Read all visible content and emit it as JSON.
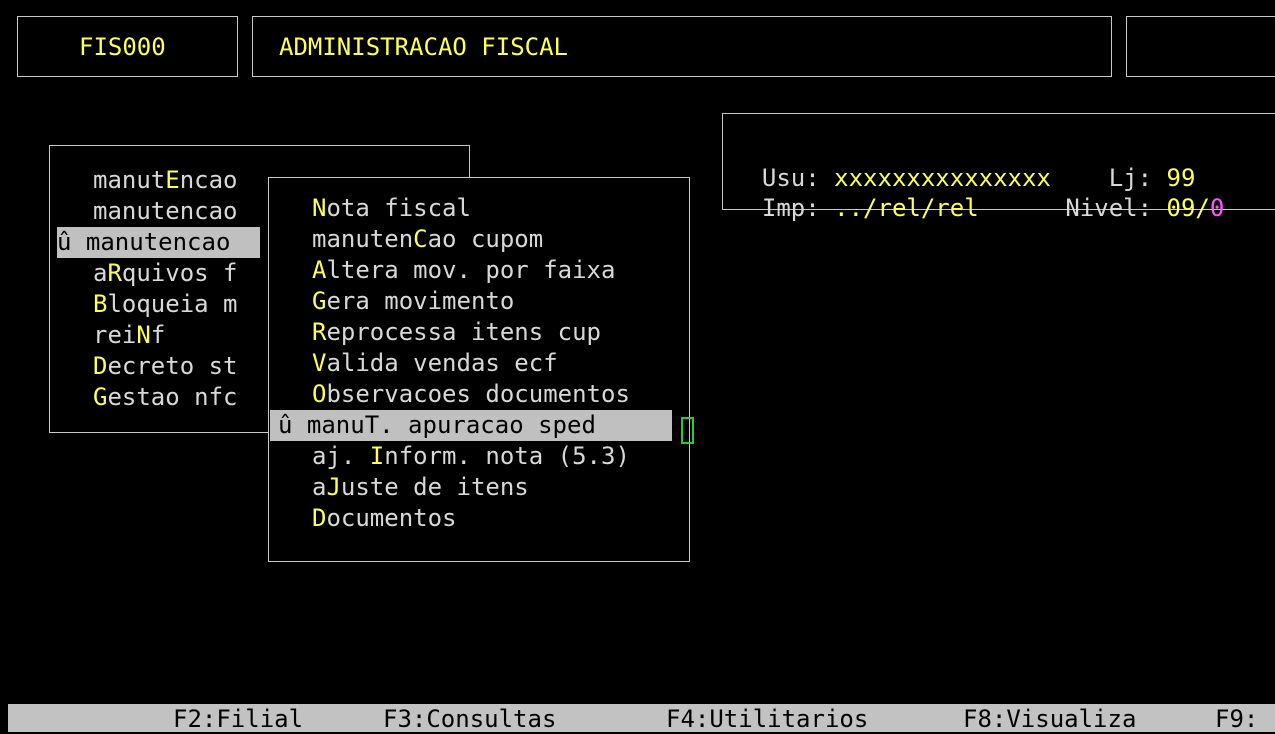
{
  "header": {
    "program_code": "FIS000",
    "title": "ADMINISTRACAO FISCAL"
  },
  "info": {
    "user_label": "Usu:",
    "user_value": "xxxxxxxxxxxxxxx",
    "store_label": "Lj:",
    "store_value": "99",
    "printer_label": "Imp:",
    "printer_value": "../rel/rel",
    "level_label": "Nivel:",
    "level_value": "09/",
    "level_cut": "0"
  },
  "main_menu": {
    "selected_marker": "û",
    "items": [
      {
        "pre": "manut",
        "key": "E",
        "post": "ncao"
      },
      {
        "pre": "manutencao",
        "key": "",
        "post": ""
      },
      {
        "pre": "manutencao",
        "key": "",
        "post": "",
        "selected": true
      },
      {
        "pre": "a",
        "key": "R",
        "post": "quivos f"
      },
      {
        "pre": "",
        "key": "B",
        "post": "loqueia m"
      },
      {
        "pre": "rei",
        "key": "N",
        "post": "f"
      },
      {
        "pre": "",
        "key": "D",
        "post": "ecreto st"
      },
      {
        "pre": "",
        "key": "G",
        "post": "estao nfc"
      }
    ]
  },
  "sub_menu": {
    "selected_marker": "û",
    "items": [
      {
        "pre": "",
        "key": "N",
        "post": "ota fiscal"
      },
      {
        "pre": "manuten",
        "key": "C",
        "post": "ao cupom"
      },
      {
        "pre": "",
        "key": "A",
        "post": "ltera mov. por faixa"
      },
      {
        "pre": "",
        "key": "G",
        "post": "era movimento"
      },
      {
        "pre": "",
        "key": "R",
        "post": "eprocessa itens cup"
      },
      {
        "pre": "",
        "key": "V",
        "post": "alida vendas ecf"
      },
      {
        "pre": "",
        "key": "O",
        "post": "bservacoes documentos"
      },
      {
        "pre": "manuT. apuracao sped",
        "key": "",
        "post": "",
        "selected": true
      },
      {
        "pre": "aj. ",
        "key": "I",
        "post": "nform. nota (5.3)"
      },
      {
        "pre": "a",
        "key": "J",
        "post": "uste de itens"
      },
      {
        "pre": "",
        "key": "D",
        "post": "ocumentos"
      }
    ]
  },
  "function_bar": [
    {
      "label": "F2:Filial"
    },
    {
      "label": "F3:Consultas"
    },
    {
      "label": "F4:Utilitarios"
    },
    {
      "label": "F8:Visualiza"
    },
    {
      "label": "F9:"
    }
  ]
}
